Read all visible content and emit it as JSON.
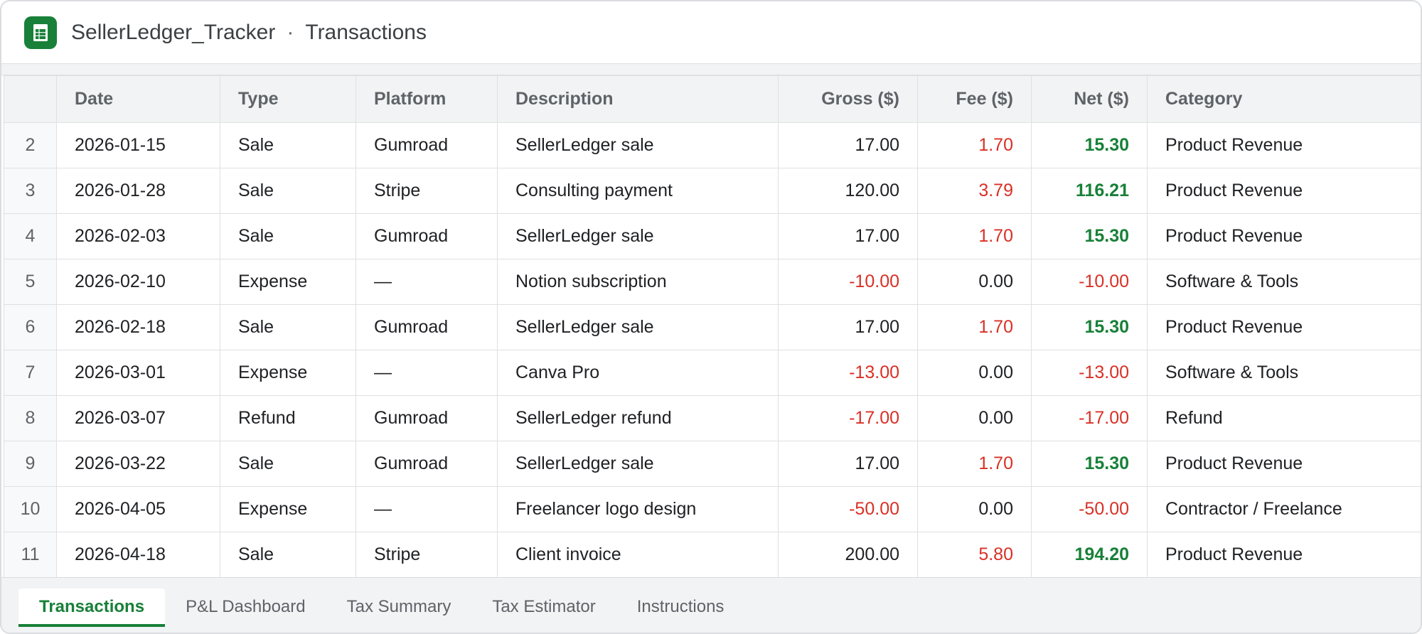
{
  "window": {
    "file_name": "SellerLedger_Tracker",
    "separator": "·",
    "sheet_name": "Transactions"
  },
  "colors": {
    "accent": "#188038",
    "negative": "#d93025",
    "positive": "#188038"
  },
  "grid": {
    "columns": [
      "Date",
      "Type",
      "Platform",
      "Description",
      "Gross ($)",
      "Fee ($)",
      "Net ($)",
      "Category"
    ],
    "rows": [
      {
        "row": "2",
        "date": "2026-01-15",
        "type": "Sale",
        "platform": "Gumroad",
        "description": "SellerLedger sale",
        "gross": "17.00",
        "fee": "1.70",
        "net": "15.30",
        "category": "Product Revenue"
      },
      {
        "row": "3",
        "date": "2026-01-28",
        "type": "Sale",
        "platform": "Stripe",
        "description": "Consulting payment",
        "gross": "120.00",
        "fee": "3.79",
        "net": "116.21",
        "category": "Product Revenue"
      },
      {
        "row": "4",
        "date": "2026-02-03",
        "type": "Sale",
        "platform": "Gumroad",
        "description": "SellerLedger sale",
        "gross": "17.00",
        "fee": "1.70",
        "net": "15.30",
        "category": "Product Revenue"
      },
      {
        "row": "5",
        "date": "2026-02-10",
        "type": "Expense",
        "platform": "—",
        "description": "Notion subscription",
        "gross": "-10.00",
        "fee": "0.00",
        "net": "-10.00",
        "category": "Software & Tools"
      },
      {
        "row": "6",
        "date": "2026-02-18",
        "type": "Sale",
        "platform": "Gumroad",
        "description": "SellerLedger sale",
        "gross": "17.00",
        "fee": "1.70",
        "net": "15.30",
        "category": "Product Revenue"
      },
      {
        "row": "7",
        "date": "2026-03-01",
        "type": "Expense",
        "platform": "—",
        "description": "Canva Pro",
        "gross": "-13.00",
        "fee": "0.00",
        "net": "-13.00",
        "category": "Software & Tools"
      },
      {
        "row": "8",
        "date": "2026-03-07",
        "type": "Refund",
        "platform": "Gumroad",
        "description": "SellerLedger refund",
        "gross": "-17.00",
        "fee": "0.00",
        "net": "-17.00",
        "category": "Refund"
      },
      {
        "row": "9",
        "date": "2026-03-22",
        "type": "Sale",
        "platform": "Gumroad",
        "description": "SellerLedger sale",
        "gross": "17.00",
        "fee": "1.70",
        "net": "15.30",
        "category": "Product Revenue"
      },
      {
        "row": "10",
        "date": "2026-04-05",
        "type": "Expense",
        "platform": "—",
        "description": "Freelancer logo design",
        "gross": "-50.00",
        "fee": "0.00",
        "net": "-50.00",
        "category": "Contractor / Freelance"
      },
      {
        "row": "11",
        "date": "2026-04-18",
        "type": "Sale",
        "platform": "Stripe",
        "description": "Client invoice",
        "gross": "200.00",
        "fee": "5.80",
        "net": "194.20",
        "category": "Product Revenue"
      }
    ]
  },
  "tabs": [
    {
      "label": "Transactions",
      "active": true
    },
    {
      "label": "P&L Dashboard",
      "active": false
    },
    {
      "label": "Tax Summary",
      "active": false
    },
    {
      "label": "Tax Estimator",
      "active": false
    },
    {
      "label": "Instructions",
      "active": false
    }
  ]
}
